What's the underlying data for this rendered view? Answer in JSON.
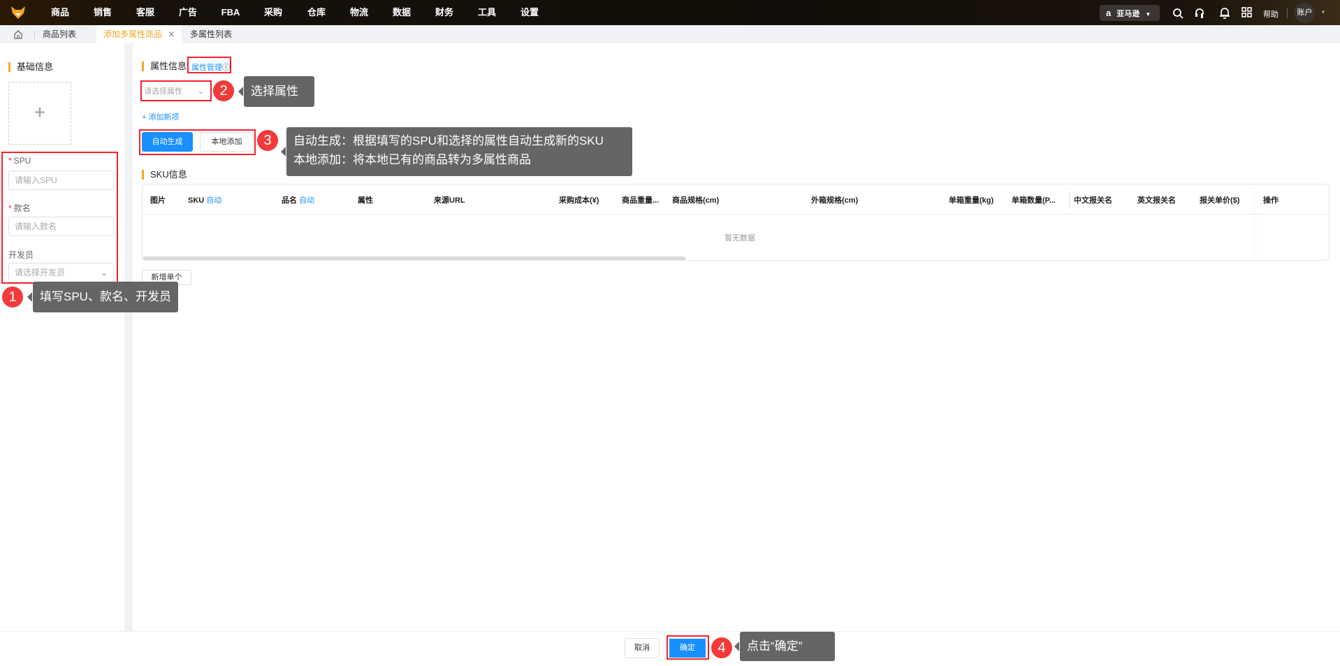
{
  "nav": {
    "items": [
      "商品",
      "销售",
      "客服",
      "广告",
      "FBA",
      "采购",
      "仓库",
      "物流",
      "数据",
      "财务",
      "工具",
      "设置"
    ],
    "platform": "亚马逊",
    "help": "帮助",
    "account": "账户",
    "icons": [
      "search-icon",
      "headset-icon",
      "bell-icon",
      "apps-icon"
    ]
  },
  "tabs": {
    "items": [
      {
        "label": "商品列表"
      },
      {
        "label": "添加多属性商品",
        "active": true
      },
      {
        "label": "多属性列表"
      }
    ]
  },
  "basic": {
    "title": "基础信息",
    "spu_label": "SPU",
    "spu_placeholder": "请输入SPU",
    "name_label": "款名",
    "name_placeholder": "请输入款名",
    "dev_label": "开发员",
    "dev_placeholder": "请选择开发员"
  },
  "attr": {
    "title": "属性信息",
    "manage": "属性管理",
    "select_placeholder": "请选择属性",
    "add_new": "添加新项",
    "auto_gen": "自动生成",
    "local_add": "本地添加"
  },
  "sku": {
    "title": "SKU信息",
    "auto": "自动",
    "columns": [
      "图片",
      "SKU",
      "品名",
      "属性",
      "来源URL",
      "采购成本(¥)",
      "商品重量...",
      "商品规格(cm)",
      "外箱规格(cm)",
      "单箱重量(kg)",
      "单箱数量(P...",
      "中文报关名",
      "英文报关名",
      "报关单价($)",
      "操作"
    ],
    "empty": "暂无数据",
    "add_single": "新增单个"
  },
  "footer": {
    "cancel": "取消",
    "confirm": "确定"
  },
  "annotations": [
    {
      "num": "1",
      "text": "填写SPU、款名、开发员"
    },
    {
      "num": "2",
      "text": "选择属性"
    },
    {
      "num": "3",
      "line1": "自动生成：根据填写的SPU和选择的属性自动生成新的SKU",
      "line2": "本地添加：将本地已有的商品转为多属性商品"
    },
    {
      "num": "4",
      "text": "点击“确定”"
    }
  ],
  "colors": {
    "accent": "#1890ff",
    "active_tab": "#f5a623",
    "annotation": "#f23a3a"
  }
}
